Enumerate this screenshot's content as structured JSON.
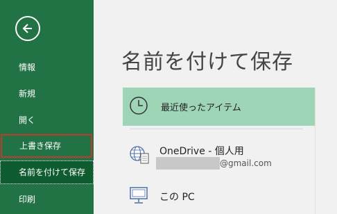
{
  "sidebar": {
    "back_icon": "back-arrow-icon",
    "items": [
      {
        "label": "情報"
      },
      {
        "label": "新規"
      },
      {
        "label": "開く"
      },
      {
        "label": "上書き保存"
      },
      {
        "label": "名前を付けて保存"
      },
      {
        "label": "印刷"
      }
    ]
  },
  "main": {
    "title": "名前を付けて保存",
    "locations": [
      {
        "label": "最近使ったアイテム",
        "icon": "clock-icon"
      },
      {
        "label": "OneDrive - 個人用",
        "sub": "@gmail.com",
        "icon": "globe-document-icon"
      },
      {
        "label": "この PC",
        "icon": "computer-icon"
      }
    ]
  },
  "colors": {
    "sidebar_bg": "#217346",
    "sidebar_active": "#0e5c2f",
    "highlight_border": "#c0392b",
    "recent_bg": "#9fd5b7",
    "main_bg": "#f1f1f1"
  }
}
